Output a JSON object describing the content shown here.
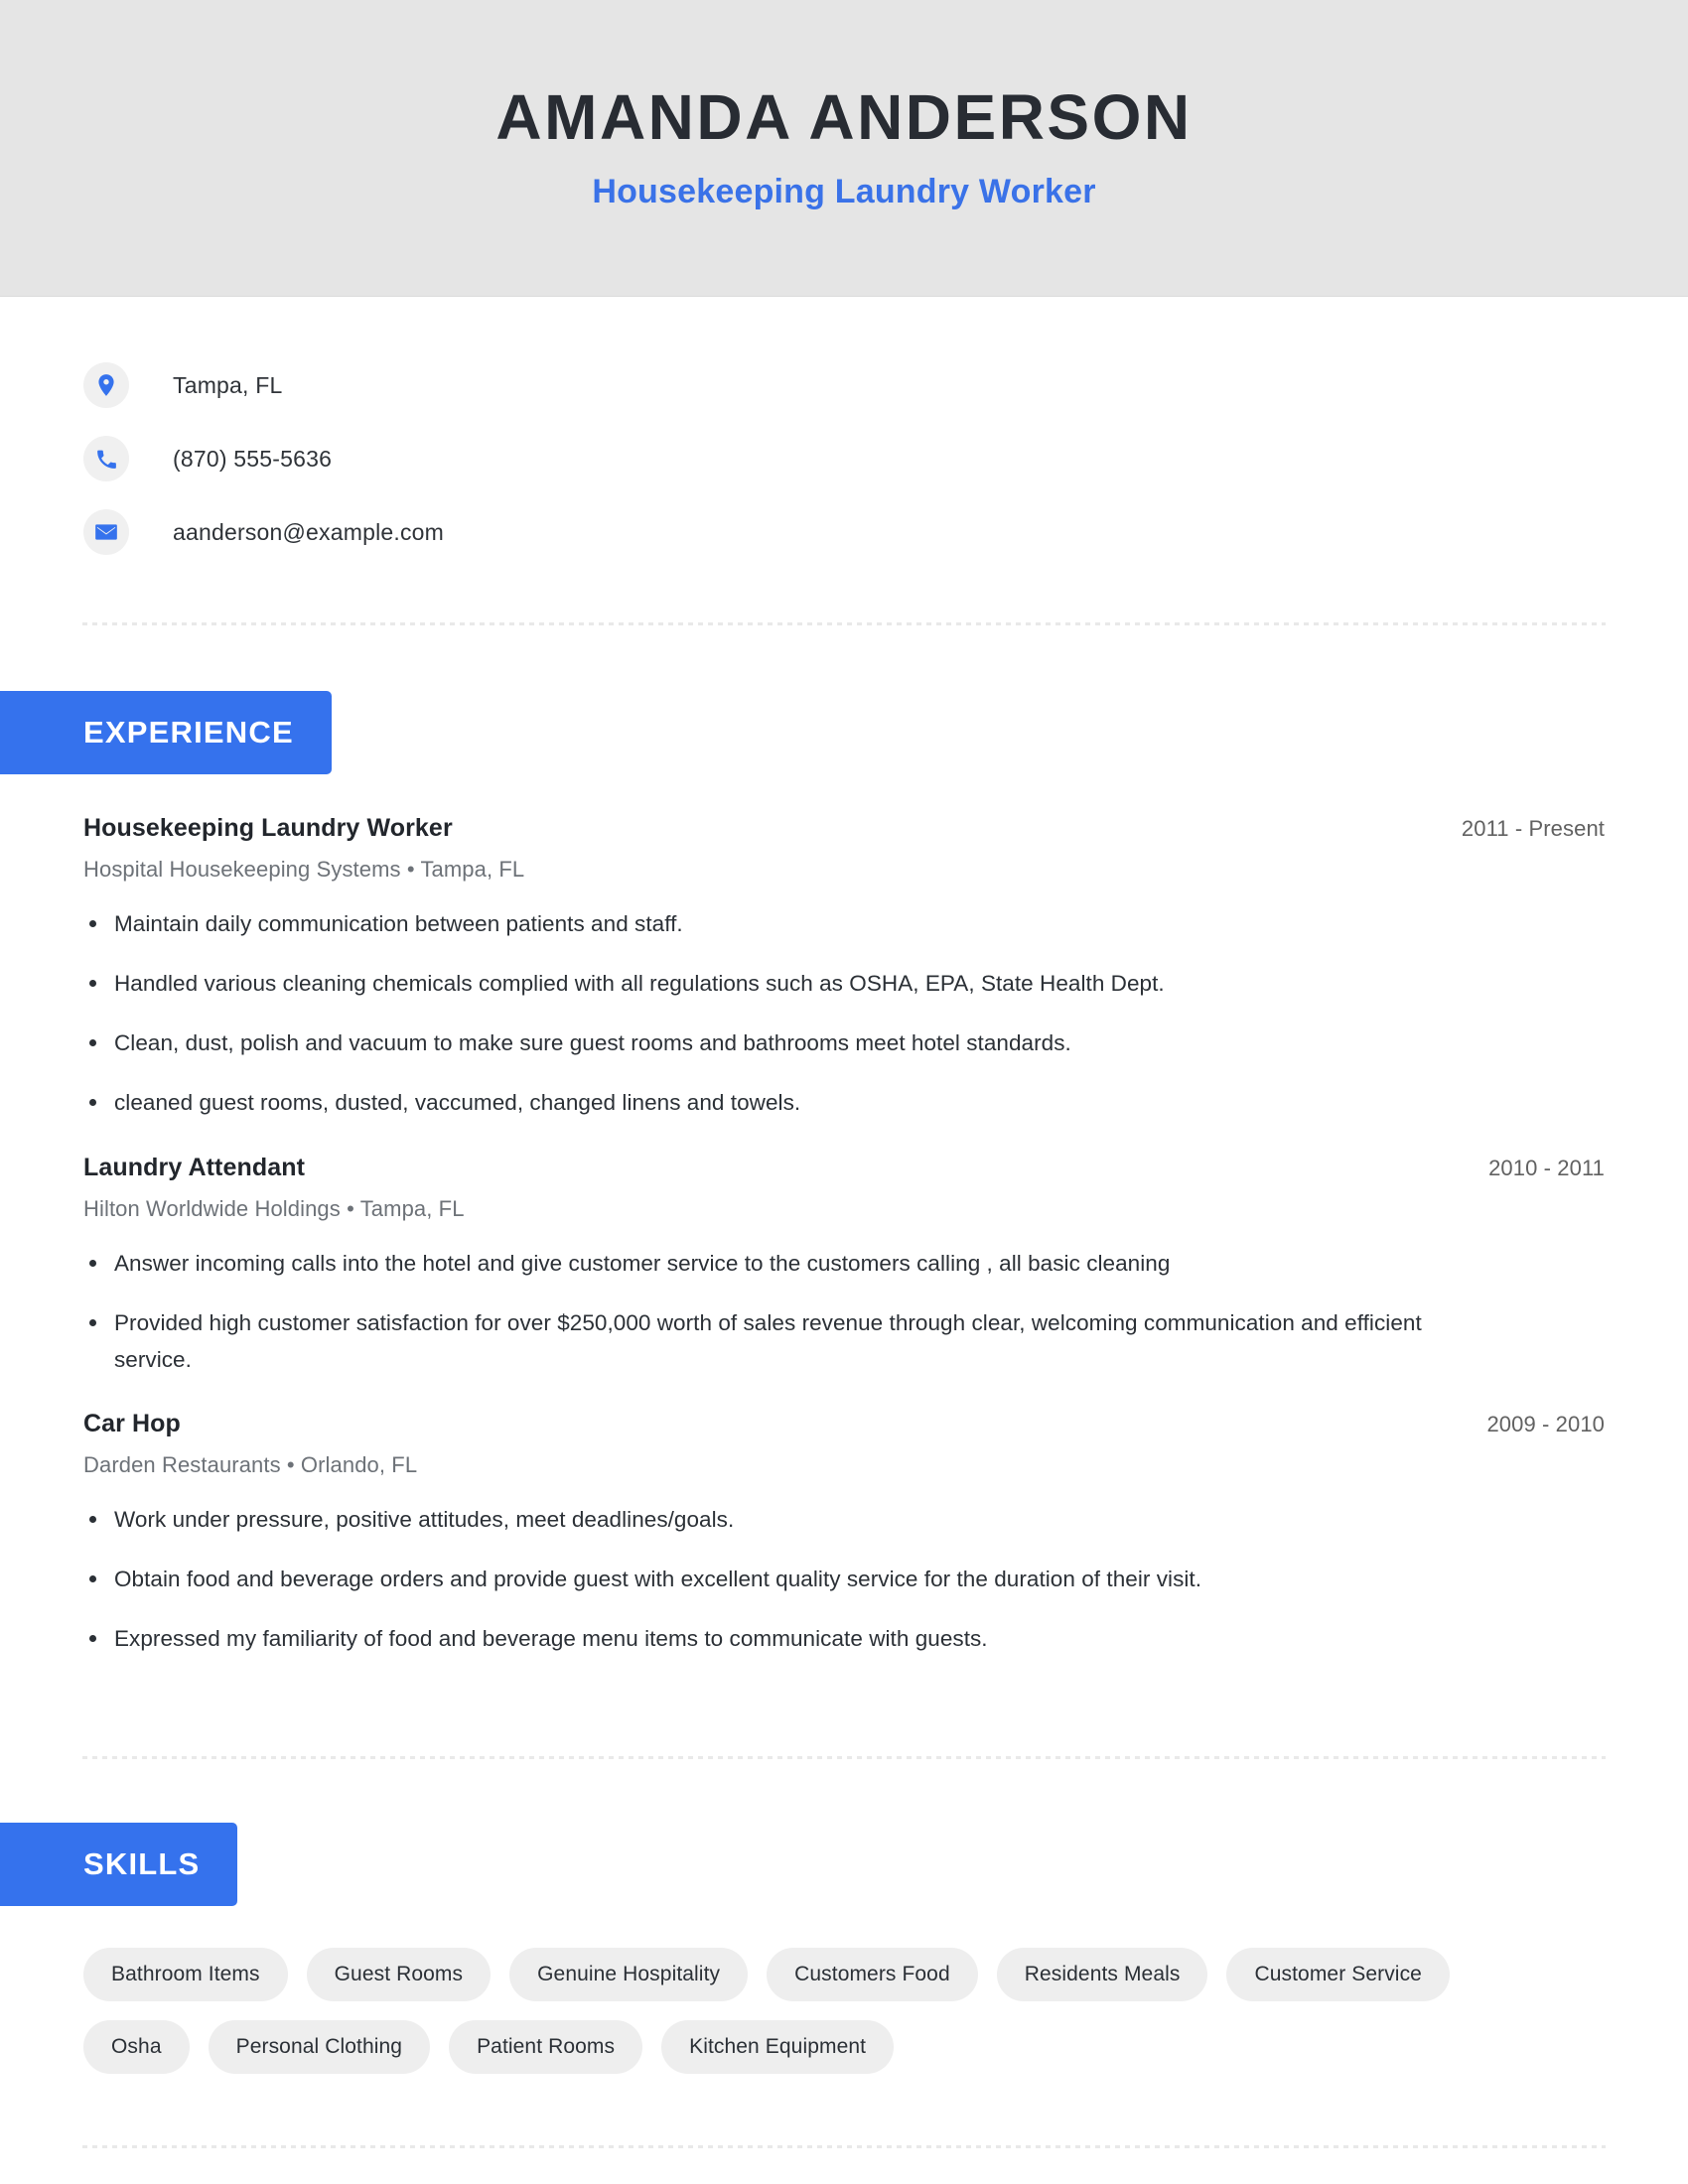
{
  "header": {
    "full_name": "AMANDA ANDERSON",
    "job_title": "Housekeeping Laundry Worker",
    "name_color": "#282c33",
    "title_color": "#3a72e8",
    "band_color": "#e5e5e5"
  },
  "theme": {
    "accent": "#3572ed",
    "text": "#2b3036",
    "muted": "#6d7278",
    "tag_bg": "#eeeeee",
    "icon_circle_bg": "#f0f0f0"
  },
  "contact": [
    {
      "icon": "location-pin-icon",
      "value": "Tampa, FL"
    },
    {
      "icon": "phone-icon",
      "value": "(870) 555-5636"
    },
    {
      "icon": "email-envelope-icon",
      "value": "aanderson@example.com"
    }
  ],
  "sections": {
    "experience": {
      "title": "EXPERIENCE",
      "items": [
        {
          "role": "Housekeeping Laundry Worker",
          "dates": "2011 - Present",
          "company": "Hospital Housekeeping Systems",
          "location": "Tampa, FL",
          "meta": "Hospital Housekeeping Systems  •  Tampa, FL",
          "bullets": [
            "Maintain daily communication between patients and staff.",
            "Handled various cleaning chemicals complied with all regulations such as OSHA, EPA, State Health Dept.",
            "Clean, dust, polish and vacuum to make sure guest rooms and bathrooms meet hotel standards.",
            "cleaned guest rooms, dusted, vaccumed, changed linens and towels."
          ]
        },
        {
          "role": "Laundry Attendant",
          "dates": "2010 - 2011",
          "company": "Hilton Worldwide Holdings",
          "location": "Tampa, FL",
          "meta": "Hilton Worldwide Holdings  •  Tampa, FL",
          "bullets": [
            "Answer incoming calls into the hotel and give customer service to the customers calling , all basic cleaning",
            "Provided high customer satisfaction for over $250,000 worth of sales revenue through clear, welcoming communication and efficient service."
          ]
        },
        {
          "role": "Car Hop",
          "dates": "2009 - 2010",
          "company": "Darden Restaurants",
          "location": "Orlando, FL",
          "meta": "Darden Restaurants  •  Orlando, FL",
          "bullets": [
            "Work under pressure, positive attitudes, meet deadlines/goals.",
            "Obtain food and beverage orders and provide guest with excellent quality service for the duration of their visit.",
            "Expressed my familiarity of food and beverage menu items to communicate with guests."
          ]
        }
      ]
    },
    "skills": {
      "title": "SKILLS",
      "items": [
        "Bathroom Items",
        "Guest Rooms",
        "Genuine Hospitality",
        "Customers Food",
        "Residents Meals",
        "Customer Service",
        "Osha",
        "Personal Clothing",
        "Patient Rooms",
        "Kitchen Equipment"
      ]
    }
  }
}
